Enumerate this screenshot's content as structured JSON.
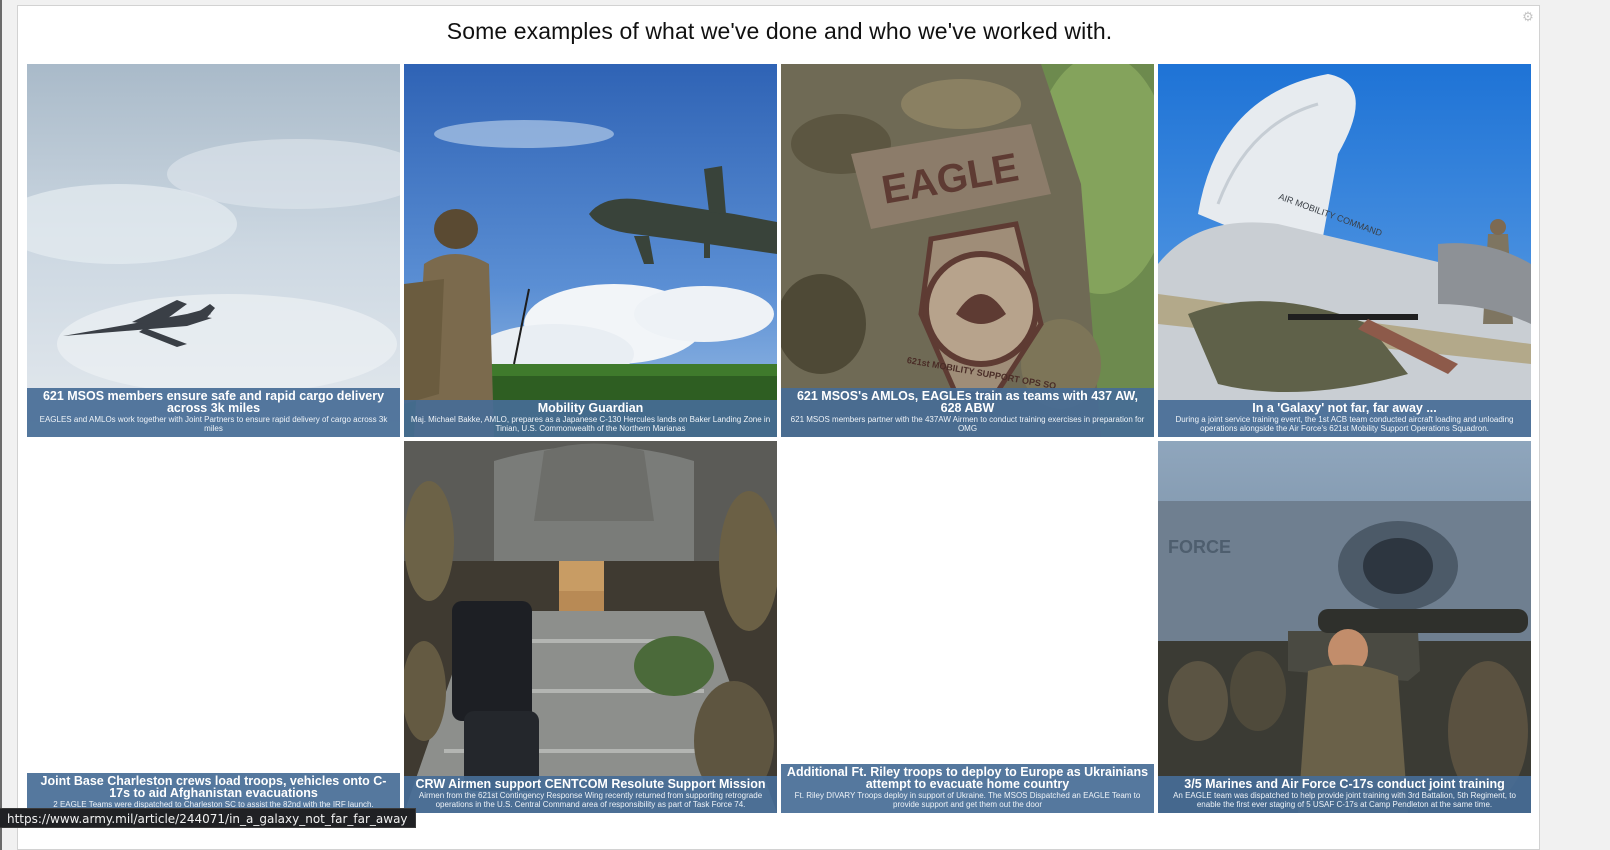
{
  "page": {
    "title": "Some examples of what we've done and who we've worked with."
  },
  "icons": {
    "settings": "gear-icon"
  },
  "colors": {
    "caption_bg": "#466c96",
    "caption_text": "#ffffff",
    "status_bar_bg": "#202124"
  },
  "cards": [
    {
      "title": "621 MSOS members ensure safe and rapid cargo delivery across 3k miles",
      "description": "EAGLES and AMLOs work together with Joint Partners to ensure rapid delivery of cargo across 3k miles"
    },
    {
      "title": "Mobility Guardian",
      "description": "Maj. Michael Bakke, AMLO, prepares as a Japanese C-130 Hercules lands on Baker Landing Zone in Tinian, U.S. Commonwealth of the Northern Marianas"
    },
    {
      "title": "621 MSOS's AMLOs, EAGLEs train as teams with 437 AW, 628 ABW",
      "description": "621 MSOS members partner with the 437AW Airmen to conduct training exercises in preparation for OMG"
    },
    {
      "title": "In a 'Galaxy' not far, far away ...",
      "description": "During a joint service training event, the 1st ACB team conducted aircraft loading and unloading operations alongside the Air Force's 621st Mobility Support Operations Squadron."
    },
    {
      "title": "Joint Base Charleston crews load troops, vehicles onto C-17s to aid Afghanistan evacuations",
      "description": "2 EAGLE Teams were dispatched to Charleston SC to assist the 82nd with the IRF launch."
    },
    {
      "title": "CRW Airmen support CENTCOM Resolute Support Mission",
      "description": "Airmen from the 621st Contingency Response Wing recently returned from supporting retrograde operations in the U.S. Central Command area of responsibility as part of Task Force 74."
    },
    {
      "title": "Additional Ft. Riley troops to deploy to Europe as Ukrainians attempt to evacuate home country",
      "description": "Ft. Riley DIVARY Troops deploy in support of Ukraine. The MSOS Dispatched an EAGLE Team to provide support and get them out the door"
    },
    {
      "title": "3/5 Marines and Air Force C-17s conduct joint training",
      "description": "An EAGLE team was dispatched to help provide joint training with 3rd Battalion, 5th Regiment, to enable the first ever staging of 5 USAF C-17s at Camp Pendleton at the same time."
    }
  ],
  "photo_text": {
    "patch_tab": "EAGLE",
    "patch_ring": "621st MOBILITY SUPPORT OPS SQ",
    "aircraft_marking": "AIR MOBILITY COMMAND",
    "fuselage_text": "FORCE"
  },
  "status_bar": {
    "url": "https://www.army.mil/article/244071/in_a_galaxy_not_far_far_away"
  }
}
